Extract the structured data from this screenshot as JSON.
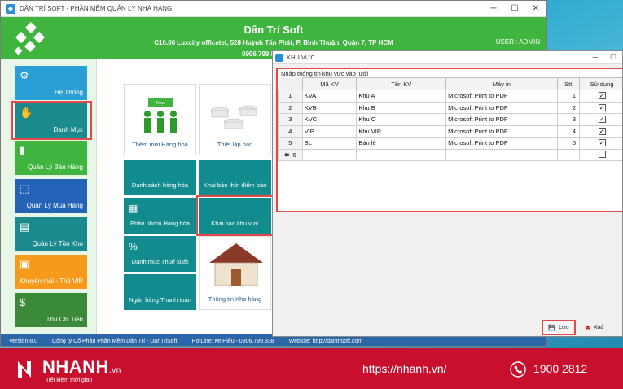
{
  "window": {
    "title": "DÂN TRÍ SOFT - PHẦN MỀM QUẢN LÝ NHÀ HÀNG"
  },
  "header": {
    "company": "Dân Trí Soft",
    "address": "C10.06 Luxcity officetel, 528 Huỳnh Tấn Phát, P. Bình Thuận, Quận 7, TP HCM",
    "phone": "0906.799.8",
    "user": "USER : ADMIN"
  },
  "sidebar": {
    "items": [
      {
        "label": "Hệ Thống",
        "icon": "gears-icon",
        "color": "#2a9fd6"
      },
      {
        "label": "Danh Mục",
        "icon": "hand-box-icon",
        "color": "#1a8a8f"
      },
      {
        "label": "Quản Lý Bán Hàng",
        "icon": "bar-chart-icon",
        "color": "#3fb43f"
      },
      {
        "label": "Quản Lý Mua Hàng",
        "icon": "buy-icon",
        "color": "#2563b8"
      },
      {
        "label": "Quản Lý Tồn Kho",
        "icon": "inventory-icon",
        "color": "#1a8a8f"
      },
      {
        "label": "Khuyến mãi - Thẻ VIP",
        "icon": "vip-card-icon",
        "color": "#f59a1b"
      },
      {
        "label": "Thu Chi Tiền",
        "icon": "money-icon",
        "color": "#3a8a3a"
      }
    ]
  },
  "tiles": [
    {
      "label": "Thêm mới Hàng hoá",
      "icon": "new-products-icon"
    },
    {
      "label": "Thiết lập bàn",
      "icon": "tables-icon"
    },
    {
      "label": "Danh sách hàng hóa",
      "icon": ""
    },
    {
      "label": "Khai báo thời điểm bán",
      "icon": ""
    },
    {
      "label": "Phân nhóm Hàng hóa",
      "icon": "group-icon"
    },
    {
      "label": "Khai báo khu vực",
      "icon": ""
    },
    {
      "label": "Danh mục Thuế suất",
      "icon": "percent-icon"
    },
    {
      "label": "Ngân hàng Thanh toán",
      "icon": ""
    },
    {
      "label": "Thông tin Kho hàng",
      "icon": "warehouse-icon"
    }
  ],
  "footer": {
    "version": "Version 8.0",
    "company": "Công ty Cổ Phần Phần Mềm Dân Trí - DanTriSoft",
    "hotline": "HotLine: Mr.Hiếu - 0906.799.838",
    "website": "Website: http://dantrisoft.com"
  },
  "dialog": {
    "title": "KHU VỰC",
    "caption": "Nhập thông tin khu vực vào lưới",
    "columns": [
      "Mã KV",
      "Tên KV",
      "Máy in",
      "Stt",
      "Sử dụng"
    ],
    "rows": [
      {
        "num": "1",
        "code": "KVA",
        "name": "Khu A",
        "printer": "Microsoft Print to PDF",
        "stt": "1",
        "used": true
      },
      {
        "num": "2",
        "code": "KVB",
        "name": "Khu B",
        "printer": "Microsoft Print to PDF",
        "stt": "2",
        "used": true
      },
      {
        "num": "3",
        "code": "KVC",
        "name": "Khu C",
        "printer": "Microsoft Print to PDF",
        "stt": "3",
        "used": true
      },
      {
        "num": "4",
        "code": "VIP",
        "name": "Khu VIP",
        "printer": "Microsoft Print to PDF",
        "stt": "4",
        "used": true
      },
      {
        "num": "5",
        "code": "BL",
        "name": "Bán lẻ",
        "printer": "Microsoft Print to PDF",
        "stt": "5",
        "used": true
      },
      {
        "num": "6",
        "code": "",
        "name": "",
        "printer": "",
        "stt": "",
        "used": false
      }
    ],
    "new_row_marker": "✱",
    "save_label": "Lưu",
    "delete_label": "Xoá"
  },
  "banner": {
    "brand": "NHANH",
    "brand_suffix": ".vn",
    "tagline": "Tiết kiệm thời gian",
    "url": "https://nhanh.vn/",
    "hotline": "1900 2812"
  }
}
